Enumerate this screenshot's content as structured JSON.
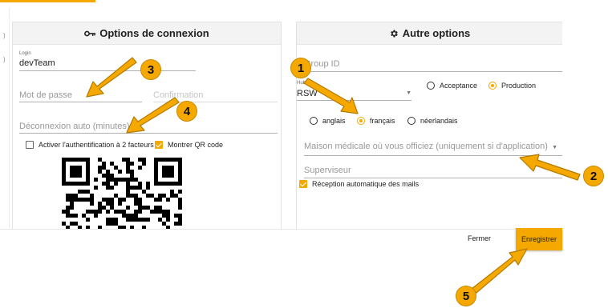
{
  "colors": {
    "accent": "#f5a800",
    "panel_header_bg": "#f3f3f3"
  },
  "left_panel": {
    "title": "Options de connexion",
    "title_icon": "key-icon",
    "login": {
      "label": "Login",
      "value": "devTeam"
    },
    "password": {
      "placeholder": "Mot de passe"
    },
    "confirmation": {
      "placeholder": "Confirmation"
    },
    "auto_logout": {
      "placeholder": "Déconnexion auto (minutes)"
    },
    "two_factor": {
      "label": "Activer l'authentification à 2 facteurs",
      "checked": false
    },
    "show_qr": {
      "label": "Montrer QR code",
      "checked": true
    },
    "qr_icon": "qr-code-icon"
  },
  "right_panel": {
    "title": "Autre options",
    "title_icon": "gear-icon",
    "group_id": {
      "placeholder": "Group ID"
    },
    "hub": {
      "label": "Hub eH",
      "value": "RSW"
    },
    "environment": {
      "options": [
        "Acceptance",
        "Production"
      ],
      "selected": "Production"
    },
    "language": {
      "options": [
        "anglais",
        "français",
        "néerlandais"
      ],
      "selected": "français"
    },
    "medical_house": {
      "placeholder": "Maison médicale où vous officiez (uniquement si d'application)"
    },
    "supervisor": {
      "placeholder": "Superviseur"
    },
    "auto_mail": {
      "label": "Réception automatique des mails",
      "checked": true
    }
  },
  "footer": {
    "close_label": "Fermer",
    "save_label": "Enregistrer"
  },
  "callouts": [
    "1",
    "2",
    "3",
    "4",
    "5"
  ]
}
